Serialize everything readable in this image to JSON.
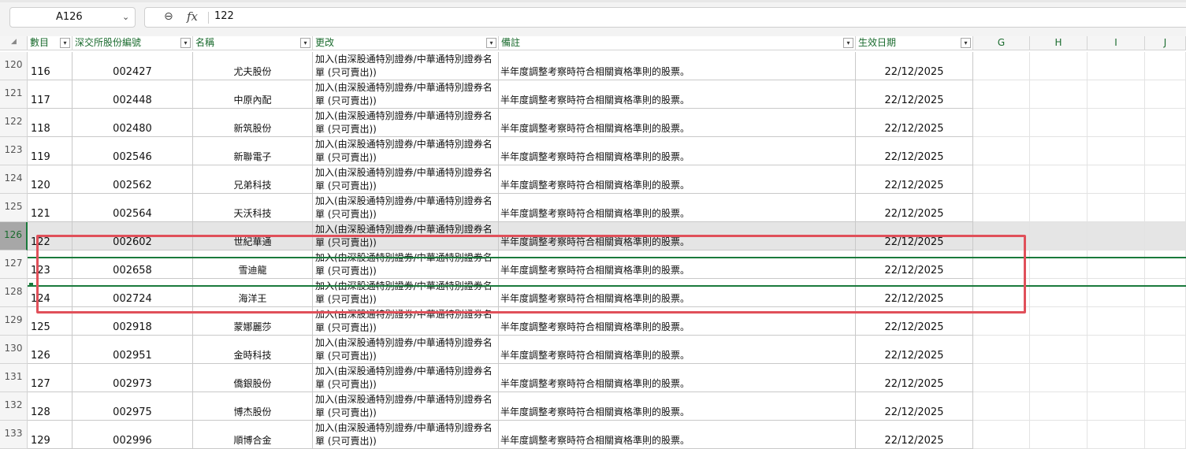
{
  "formula_bar": {
    "name_box": "A126",
    "name_box_icon": "chevron-down-icon",
    "zoom_icon": "magnifier-minus-icon",
    "fx_label": "fx",
    "formula_value": "122"
  },
  "columns": [
    {
      "letter": "A",
      "header": "數目",
      "filter": true
    },
    {
      "letter": "B",
      "header": "深交所股份編號",
      "filter": true
    },
    {
      "letter": "C",
      "header": "名稱",
      "filter": true
    },
    {
      "letter": "D",
      "header": "更改",
      "filter": true
    },
    {
      "letter": "E",
      "header": "備註",
      "filter": true
    },
    {
      "letter": "F",
      "header": "生效日期",
      "filter": true
    },
    {
      "letter": "G",
      "header": "G",
      "filter": false
    },
    {
      "letter": "H",
      "header": "H",
      "filter": false
    },
    {
      "letter": "I",
      "header": "I",
      "filter": false
    },
    {
      "letter": "J",
      "header": "J",
      "filter": false
    }
  ],
  "filter_icon": "▾",
  "selected_row": "126",
  "rows": [
    {
      "row_num": "120",
      "num": "116",
      "code": "002427",
      "name": "尤夫股份",
      "change": "加入(由深股通特別證券/中華通特別證券名單 (只可賣出))",
      "note": "半年度調整考察時符合相關資格準則的股票。",
      "date": "22/12/2025"
    },
    {
      "row_num": "121",
      "num": "117",
      "code": "002448",
      "name": "中原內配",
      "change": "加入(由深股通特別證券/中華通特別證券名單 (只可賣出))",
      "note": "半年度調整考察時符合相關資格準則的股票。",
      "date": "22/12/2025"
    },
    {
      "row_num": "122",
      "num": "118",
      "code": "002480",
      "name": "新筑股份",
      "change": "加入(由深股通特別證券/中華通特別證券名單 (只可賣出))",
      "note": "半年度調整考察時符合相關資格準則的股票。",
      "date": "22/12/2025"
    },
    {
      "row_num": "123",
      "num": "119",
      "code": "002546",
      "name": "新聯電子",
      "change": "加入(由深股通特別證券/中華通特別證券名單 (只可賣出))",
      "note": "半年度調整考察時符合相關資格準則的股票。",
      "date": "22/12/2025"
    },
    {
      "row_num": "124",
      "num": "120",
      "code": "002562",
      "name": "兄弟科技",
      "change": "加入(由深股通特別證券/中華通特別證券名單 (只可賣出))",
      "note": "半年度調整考察時符合相關資格準則的股票。",
      "date": "22/12/2025"
    },
    {
      "row_num": "125",
      "num": "121",
      "code": "002564",
      "name": "天沃科技",
      "change": "加入(由深股通特別證券/中華通特別證券名單 (只可賣出))",
      "note": "半年度調整考察時符合相關資格準則的股票。",
      "date": "22/12/2025"
    },
    {
      "row_num": "126",
      "num": "122",
      "code": "002602",
      "name": "世紀華通",
      "change": "加入(由深股通特別證券/中華通特別證券名單 (只可賣出))",
      "note": "半年度調整考察時符合相關資格準則的股票。",
      "date": "22/12/2025"
    },
    {
      "row_num": "127",
      "num": "123",
      "code": "002658",
      "name": "雪迪龍",
      "change": "加入(由深股通特別證券/中華通特別證券名單 (只可賣出))",
      "note": "半年度調整考察時符合相關資格準則的股票。",
      "date": "22/12/2025"
    },
    {
      "row_num": "128",
      "num": "124",
      "code": "002724",
      "name": "海洋王",
      "change": "加入(由深股通特別證券/中華通特別證券名單 (只可賣出))",
      "note": "半年度調整考察時符合相關資格準則的股票。",
      "date": "22/12/2025"
    },
    {
      "row_num": "129",
      "num": "125",
      "code": "002918",
      "name": "蒙娜麗莎",
      "change": "加入(由深股通特別證券/中華通特別證券名單 (只可賣出))",
      "note": "半年度調整考察時符合相關資格準則的股票。",
      "date": "22/12/2025"
    },
    {
      "row_num": "130",
      "num": "126",
      "code": "002951",
      "name": "金時科技",
      "change": "加入(由深股通特別證券/中華通特別證券名單 (只可賣出))",
      "note": "半年度調整考察時符合相關資格準則的股票。",
      "date": "22/12/2025"
    },
    {
      "row_num": "131",
      "num": "127",
      "code": "002973",
      "name": "僑銀股份",
      "change": "加入(由深股通特別證券/中華通特別證券名單 (只可賣出))",
      "note": "半年度調整考察時符合相關資格準則的股票。",
      "date": "22/12/2025"
    },
    {
      "row_num": "132",
      "num": "128",
      "code": "002975",
      "name": "博杰股份",
      "change": "加入(由深股通特別證券/中華通特別證券名單 (只可賣出))",
      "note": "半年度調整考察時符合相關資格準則的股票。",
      "date": "22/12/2025"
    },
    {
      "row_num": "133",
      "num": "129",
      "code": "002996",
      "name": "順博合金",
      "change": "加入(由深股通特別證券/中華通特別證券名單 (只可賣出))",
      "note": "半年度調整考察時符合相關資格準則的股票。",
      "date": "22/12/2025"
    }
  ]
}
